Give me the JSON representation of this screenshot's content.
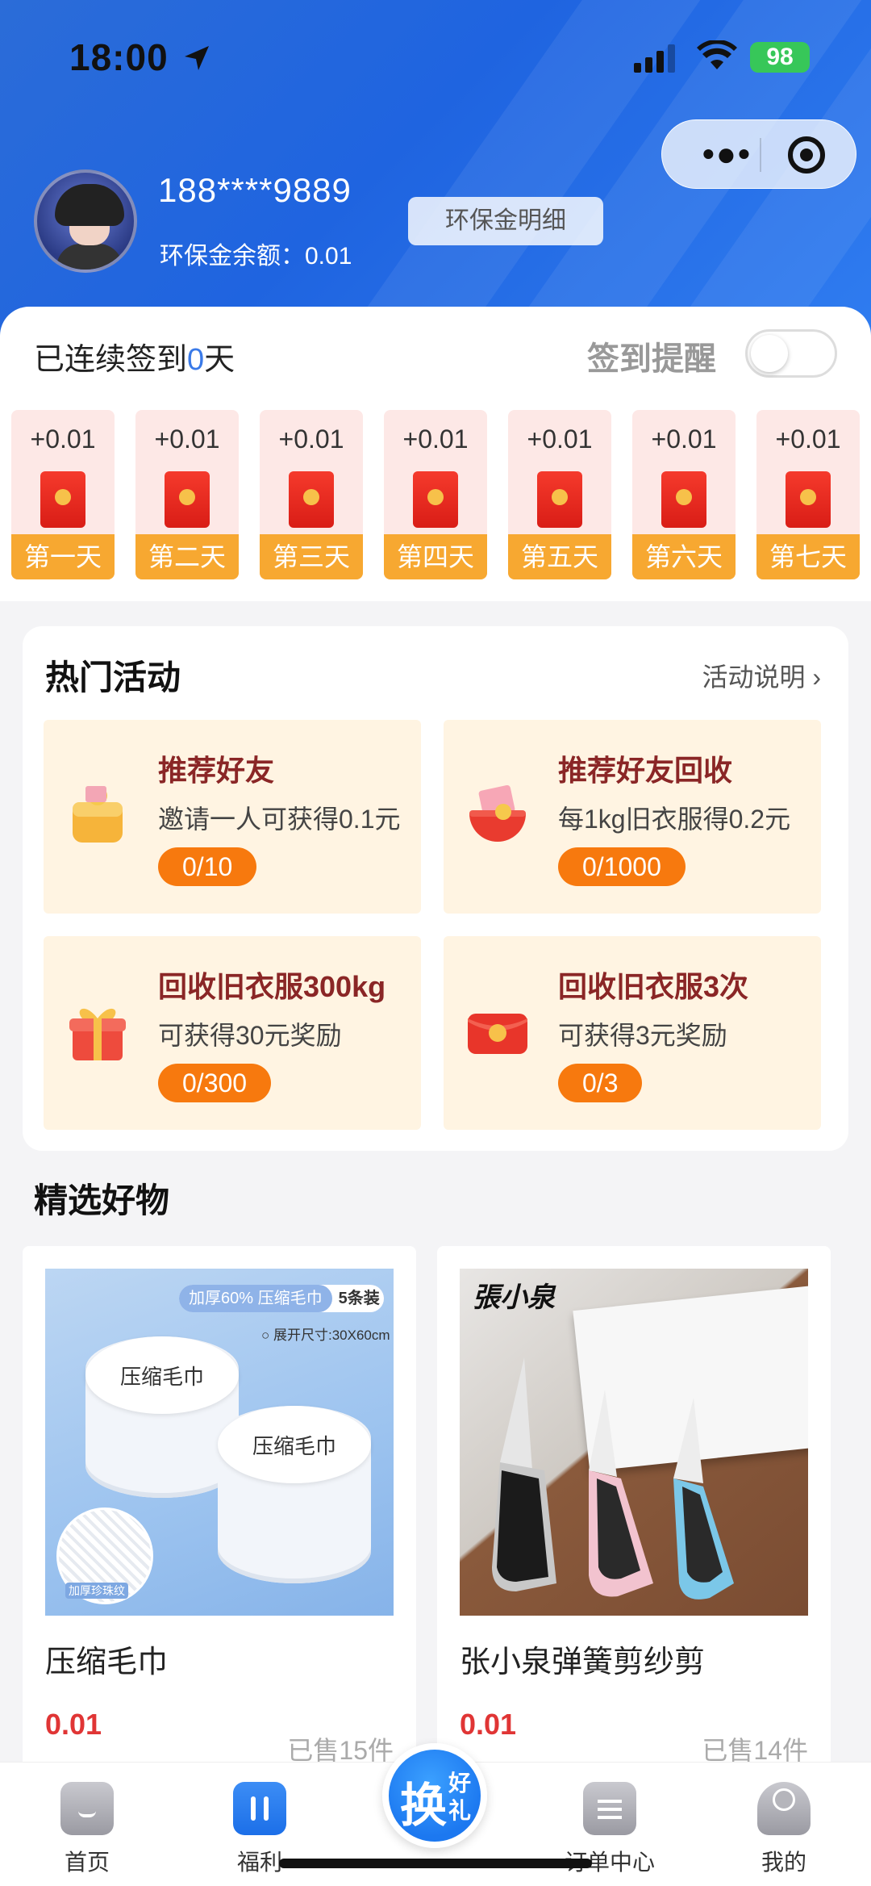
{
  "status_bar": {
    "time": "18:00",
    "battery": "98"
  },
  "header": {
    "phone": "188****9889",
    "balance_label": "环保金余额：",
    "balance_value": "0.01",
    "detail_button": "环保金明细"
  },
  "checkin": {
    "prefix": "已连续签到",
    "days_count": "0",
    "suffix": "天",
    "remind_label": "签到提醒",
    "remind_on": false,
    "days": [
      {
        "amount": "+0.01",
        "label": "第一天"
      },
      {
        "amount": "+0.01",
        "label": "第二天"
      },
      {
        "amount": "+0.01",
        "label": "第三天"
      },
      {
        "amount": "+0.01",
        "label": "第四天"
      },
      {
        "amount": "+0.01",
        "label": "第五天"
      },
      {
        "amount": "+0.01",
        "label": "第六天"
      },
      {
        "amount": "+0.01",
        "label": "第七天"
      }
    ]
  },
  "hot": {
    "title": "热门活动",
    "more_label": "活动说明",
    "cards": [
      {
        "title": "推荐好友",
        "desc": "邀请一人可获得0.1元",
        "progress": "0/10",
        "icon": "wallet-coins-icon"
      },
      {
        "title": "推荐好友回收",
        "desc": "每1kg旧衣服得0.2元",
        "progress": "0/1000",
        "icon": "money-bowl-icon"
      },
      {
        "title": "回收旧衣服300kg",
        "desc": "可获得30元奖励",
        "progress": "0/300",
        "icon": "gift-box-icon"
      },
      {
        "title": "回收旧衣服3次",
        "desc": "可获得3元奖励",
        "progress": "0/3",
        "icon": "red-envelope-icon"
      }
    ]
  },
  "picks": {
    "title": "精选好物",
    "products": [
      {
        "name": "压缩毛巾",
        "price": "0.01",
        "sold": "已售15件",
        "image_text": {
          "tag_a": "加厚60% 压缩毛巾",
          "tag_b": "5条装",
          "size": "○ 展开尺寸:30X60cm",
          "drum_label": "压缩毛巾",
          "swatch": "加厚珍珠纹"
        }
      },
      {
        "name": "张小泉弹簧剪纱剪",
        "price": "0.01",
        "sold": "已售14件",
        "image_text": {
          "brand": "張小泉"
        }
      }
    ]
  },
  "tabbar": {
    "tabs": [
      {
        "label": "首页"
      },
      {
        "label": "福利"
      },
      {
        "label": "订单中心"
      },
      {
        "label": "我的"
      }
    ],
    "center": {
      "big": "换",
      "small1": "好",
      "small2": "礼"
    }
  },
  "colors": {
    "brand_blue": "#2b6cd8",
    "accent_orange": "#f7790e",
    "price_red": "#e03535",
    "day_label": "#f7a831"
  }
}
